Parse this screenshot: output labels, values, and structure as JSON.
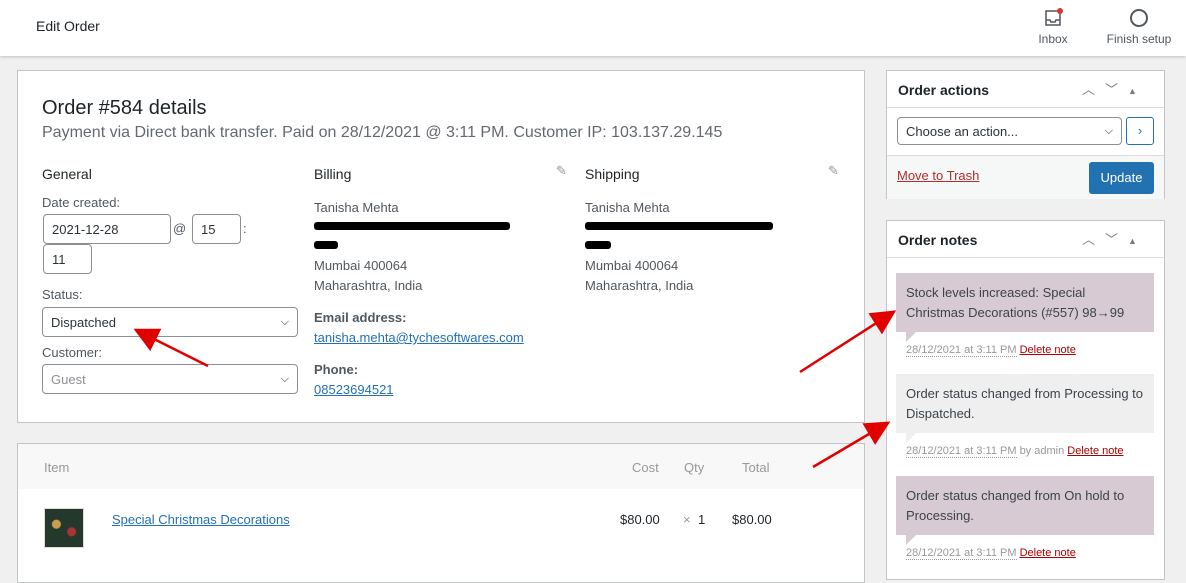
{
  "header": {
    "title": "Edit Order",
    "inbox": "Inbox",
    "finish_setup": "Finish setup"
  },
  "order": {
    "title": "Order #584 details",
    "subtitle": "Payment via Direct bank transfer. Paid on 28/12/2021 @ 3:11 PM. Customer IP: 103.137.29.145",
    "general": {
      "heading": "General",
      "date_label": "Date created:",
      "date": "2021-12-28",
      "at": "@",
      "hour": "15",
      "colon": ":",
      "minute": "11",
      "status_label": "Status:",
      "status": "Dispatched",
      "customer_label": "Customer:",
      "customer": "Guest"
    },
    "billing": {
      "heading": "Billing",
      "name": "Tanisha Mehta",
      "city": "Mumbai 400064",
      "state": "Maharashtra, India",
      "email_label": "Email address:",
      "email": "tanisha.mehta@tychesoftwares.com",
      "phone_label": "Phone:",
      "phone": "08523694521"
    },
    "shipping": {
      "heading": "Shipping",
      "name": "Tanisha Mehta",
      "city": "Mumbai 400064",
      "state": "Maharashtra, India"
    }
  },
  "items": {
    "headers": {
      "item": "Item",
      "cost": "Cost",
      "qty": "Qty",
      "total": "Total"
    },
    "rows": [
      {
        "name": "Special Christmas Decorations",
        "cost": "$80.00",
        "times": "×",
        "qty": "1",
        "total": "$80.00"
      }
    ]
  },
  "order_actions": {
    "title": "Order actions",
    "select": "Choose an action...",
    "trash": "Move to Trash",
    "update": "Update"
  },
  "order_notes": {
    "title": "Order notes",
    "notes": [
      {
        "text": "Stock levels increased: Special Christmas Decorations (#557) 98→99",
        "date": "28/12/2021 at 3:11 PM",
        "by": "",
        "delete": "Delete note"
      },
      {
        "text": "Order status changed from Processing to Dispatched.",
        "date": "28/12/2021 at 3:11 PM",
        "by": "by admin",
        "delete": "Delete note"
      },
      {
        "text": "Order status changed from On hold to Processing.",
        "date": "28/12/2021 at 3:11 PM",
        "by": "",
        "delete": "Delete note"
      }
    ]
  },
  "colors": {
    "accent": "#2271b1",
    "system_note": "#d7cad2",
    "private_note": "#efefef",
    "annotation_arrow": "#e00000"
  }
}
